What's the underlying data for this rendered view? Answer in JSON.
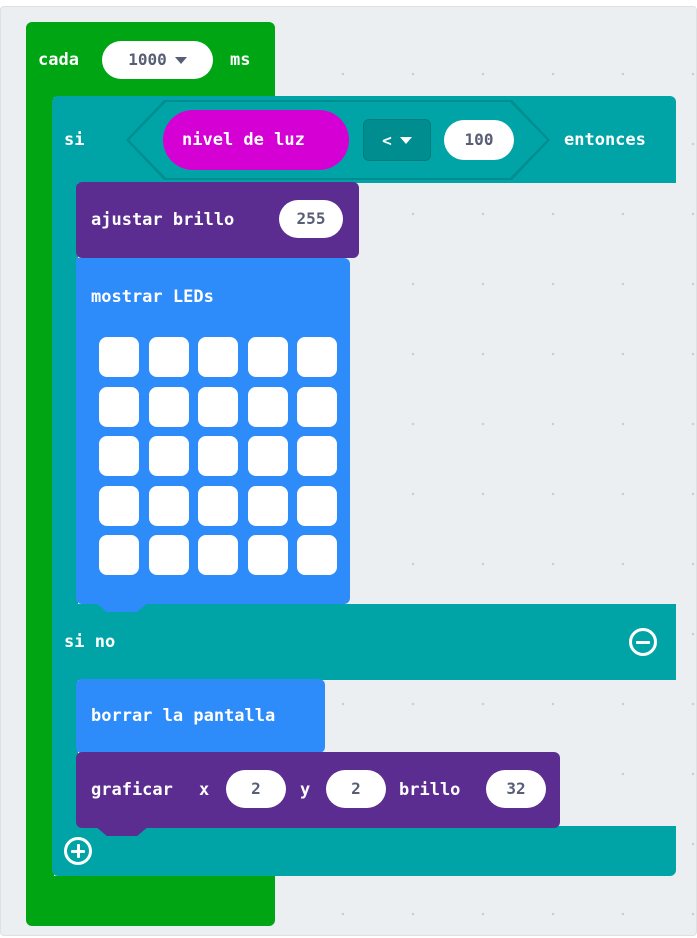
{
  "forever_block": {
    "label_every": "cada",
    "interval_value": "1000",
    "label_unit": "ms"
  },
  "if_block": {
    "label_if": "si",
    "condition": {
      "sensor_label": "nivel de luz",
      "operator": "<",
      "threshold": "100"
    },
    "label_then": "entonces",
    "label_else": "si no"
  },
  "set_brightness_block": {
    "label": "ajustar brillo",
    "value": "255"
  },
  "show_leds_block": {
    "label": "mostrar LEDs",
    "grid": [
      [
        false,
        false,
        false,
        false,
        false
      ],
      [
        false,
        false,
        false,
        false,
        false
      ],
      [
        false,
        false,
        false,
        false,
        false
      ],
      [
        false,
        false,
        false,
        false,
        false
      ],
      [
        false,
        false,
        false,
        false,
        false
      ]
    ]
  },
  "clear_screen_block": {
    "label": "borrar la pantalla"
  },
  "plot_block": {
    "label_plot": "graficar",
    "label_x": "x",
    "x_value": "2",
    "label_y": "y",
    "y_value": "2",
    "label_brightness": "brillo",
    "brightness_value": "32"
  },
  "colors": {
    "loops_green": "#00a514",
    "logic_teal": "#00a4a6",
    "led_purple": "#5c2d91",
    "basic_blue": "#2e8bfa",
    "input_pink": "#d400d4",
    "workspace_bg": "#eceff1"
  },
  "icons": {
    "remove_else": "minus-circle-icon",
    "add_branch": "plus-circle-icon"
  }
}
